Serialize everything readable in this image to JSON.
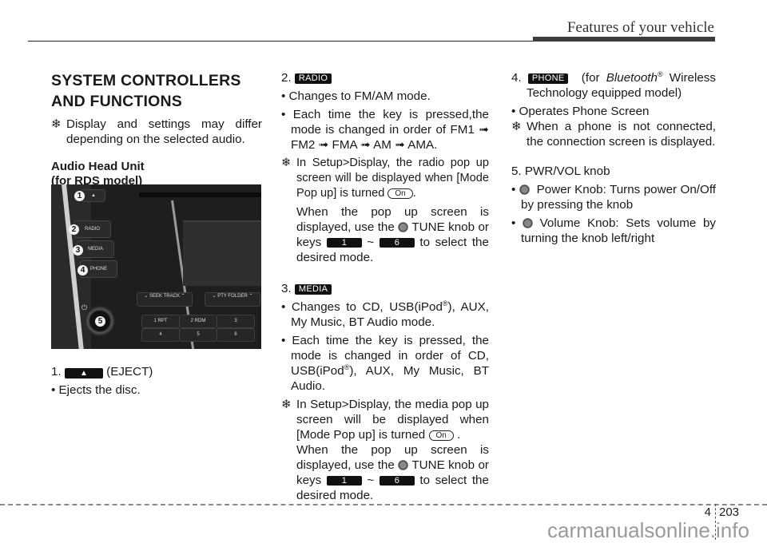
{
  "header": {
    "section_title": "Features of your vehicle"
  },
  "col1": {
    "title_line1": "SYSTEM CONTROLLERS",
    "title_line2": "AND FUNCTIONS",
    "note_symbol": "❄",
    "note": "Display and settings may differ depending on the selected audio.",
    "subtitle_line1": "Audio Head Unit",
    "subtitle_line2": "(for RDS model)",
    "photo": {
      "callouts": [
        "1",
        "2",
        "3",
        "4",
        "5"
      ],
      "side_buttons": [
        "RADIO",
        "MEDIA",
        "PHONE"
      ],
      "seek_label": "SEEK TRACK",
      "pty_label": "PTY FOLDER",
      "preset_keys": [
        "1 RPT",
        "2 RDM",
        "3",
        "4",
        "5",
        "6"
      ]
    },
    "item1_number": "1.",
    "item1_icon": "▲",
    "item1_label": "(EJECT)",
    "item1_bullet": "• Ejects the disc."
  },
  "col2": {
    "item2_number": "2.",
    "item2_badge": "RADIO",
    "item2_b1": "• Changes to FM/AM mode.",
    "item2_b2": "• Each time the key is pressed,the mode is changed in order of FM1 ➟ FM2 ➟ FMA ➟ AM ➟ AMA.",
    "item2_note_a": "In Setup>Display, the radio pop up screen will be displayed when [Mode Pop up] is turned",
    "on_label": "On",
    "item2_note_b1": "When the pop up screen is displayed, use the",
    "tune_label": "TUNE knob or keys",
    "key_first": "1",
    "tilde": "~",
    "key_last": "6",
    "select_text": "to select the desired mode.",
    "item3_number": "3.",
    "item3_badge": "MEDIA",
    "item3_b1a": "• Changes to CD, USB(iPod",
    "item3_b1b": "), AUX, My Music, BT Audio mode.",
    "reg": "®",
    "item3_b2a": "• Each time the key is pressed, the mode is changed in order of CD, USB(iPod",
    "item3_b2b": "), AUX, My Music, BT Audio.",
    "item3_note_a": "In Setup>Display, the media pop up screen will be displayed when [Mode Pop up] is turned"
  },
  "col3": {
    "item4_number": "4.",
    "item4_badge": "PHONE",
    "item4_for": "(for",
    "item4_bt": "Bluetooth",
    "item4_rest": "Wireless Technology equipped model)",
    "item4_b1": "• Operates Phone Screen",
    "item4_note": "When a phone is not connected, the connection screen is displayed.",
    "item5_title": "5. PWR/VOL knob",
    "item5_b1": "Power Knob: Turns power On/Off by pressing the knob",
    "item5_b2": "Volume Knob: Sets volume by turning the knob left/right"
  },
  "footer": {
    "section": "4",
    "page": "203",
    "watermark": "carmanualsonline.info"
  }
}
